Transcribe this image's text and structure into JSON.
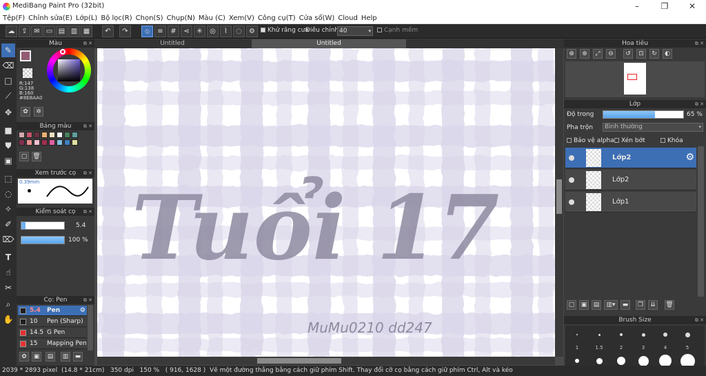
{
  "app": {
    "title": "MediBang Paint Pro (32bit)"
  },
  "window_controls": {
    "minimize": "–",
    "restore": "❐",
    "close": "✕"
  },
  "menu": [
    "Tệp(F)",
    "Chỉnh sửa(E)",
    "Lớp(L)",
    "Bộ lọc(R)",
    "Chọn(S)",
    "Chụp(N)",
    "Màu (C)",
    "Xem(V)",
    "Công cụ(T)",
    "Cửa sổ(W)",
    "Cloud",
    "Help"
  ],
  "toolbar": {
    "antialias_label": "Khử răng cưa",
    "adjust_label": "Điều chỉnh",
    "adjust_value": "40",
    "edge_label": "Cạnh mềm"
  },
  "color_panel": {
    "title": "Màu",
    "r": "R:147",
    "g": "G:138",
    "b": "B:160",
    "hex": "#8E8AA0",
    "main_color": "#935b72"
  },
  "palette_panel": {
    "title": "Bảng màu"
  },
  "brush_preview_panel": {
    "title": "Xem trước cọ",
    "size": "0.39mm"
  },
  "brush_control_panel": {
    "title": "Kiểm soát cọ",
    "size_value": "5.4",
    "opacity_value": "100 %",
    "size_fraction": 0.1,
    "opacity_fraction": 1.0
  },
  "brush_panel": {
    "title": "Cọ: Pen",
    "items": [
      {
        "size": "5.4",
        "name": "Pen",
        "color": "#1e1e1e",
        "selected": true
      },
      {
        "size": "10",
        "name": "Pen (Sharp)",
        "color": "#1e1e1e",
        "selected": false
      },
      {
        "size": "14.5",
        "name": "G Pen",
        "color": "#e83030",
        "selected": false
      },
      {
        "size": "15",
        "name": "Mapping Pen",
        "color": "#e83030",
        "selected": false
      }
    ]
  },
  "tabs": [
    {
      "label": "Untitled",
      "active": false
    },
    {
      "label": "Untitled",
      "active": true
    }
  ],
  "canvas": {
    "lettering": "Tuổi 17",
    "signature": "MuMu0210 dd247",
    "ink_color": "#8E8AA0",
    "plaid_color": "#d9d6ea"
  },
  "navigator_panel": {
    "title": "Hoa tiêu"
  },
  "layer_panel": {
    "title": "Lớp",
    "opacity_label": "Độ trong",
    "opacity_value": "65 %",
    "opacity_fraction": 0.65,
    "blend_label": "Pha trộn",
    "blend_value": "Bình thường",
    "protect_alpha": "Bảo vệ alpha",
    "clipping": "Xén bớt",
    "lock": "Khóa",
    "layers": [
      {
        "name": "Lớp2",
        "selected": true
      },
      {
        "name": "Lớp2",
        "selected": false
      },
      {
        "name": "Lớp1",
        "selected": false
      }
    ]
  },
  "brush_size_panel": {
    "title": "Brush Size",
    "labels": [
      "1",
      "1.5",
      "2",
      "3",
      "4",
      "5"
    ]
  },
  "status": {
    "size": "2039 * 2893 pixel",
    "mm": "(14.8 * 21cm)",
    "dpi": "350 dpi",
    "zoom": "150 %",
    "coords": "( 916, 1628 )",
    "hint": "Vẽ một đường thẳng bằng cách giữ phím Shift. Thay đổi cỡ cọ bằng cách giữ phím Ctrl, Alt và kéo"
  },
  "colors": {
    "accent": "#3d6fb5",
    "bar": "#6fb2f2"
  }
}
